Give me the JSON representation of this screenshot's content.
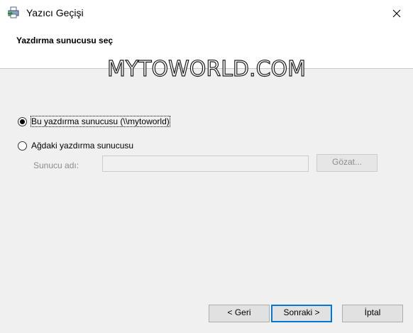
{
  "window": {
    "title": "Yazıcı Geçişi",
    "close_icon": "close-icon"
  },
  "header": {
    "title": "Yazdırma sunucusu seç"
  },
  "watermark": {
    "text": "MYTOWORLD.COM"
  },
  "options": {
    "this_server": {
      "label": "Bu yazdırma sunucusu (\\\\mytoworld)",
      "checked": true
    },
    "network_server": {
      "label": "Ağdaki yazdırma sunucusu",
      "checked": false
    }
  },
  "server_name": {
    "label": "Sunucu adı:",
    "value": "",
    "browse_label": "Gözat..."
  },
  "footer": {
    "back_label": "< Geri",
    "next_label": "Sonraki >",
    "cancel_label": "İptal"
  }
}
